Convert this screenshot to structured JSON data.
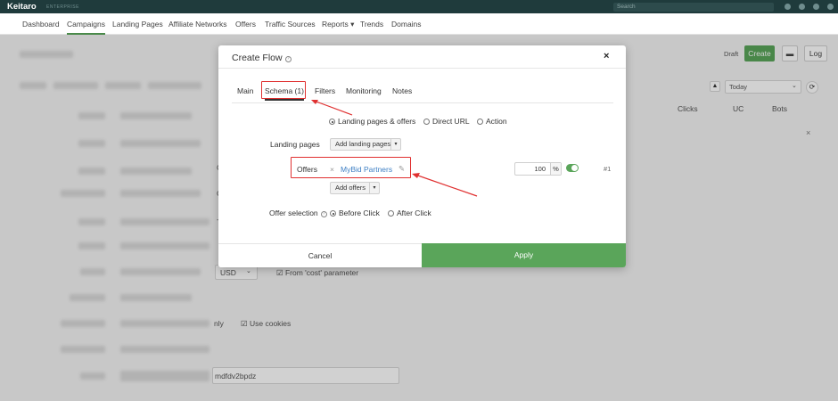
{
  "app": {
    "logo": "Keitaro",
    "logo_sub": "ENTERPRISE",
    "search_placeholder": "Search"
  },
  "nav": [
    "Dashboard",
    "Campaigns",
    "Landing Pages",
    "Affiliate Networks",
    "Offers",
    "Traffic Sources",
    "Reports ▾",
    "Trends",
    "Domains"
  ],
  "toolbar": {
    "draft": "Draft",
    "create": "Create",
    "log": "Log",
    "date_range": "Today"
  },
  "table_headers": {
    "clicks": "Clicks",
    "uc": "UC",
    "bots": "Bots"
  },
  "background": {
    "currency": "USD",
    "cost_param": "From 'cost' parameter",
    "only": "nly",
    "use_cookies": "Use cookies",
    "token": "mdfdv2bpdz"
  },
  "modal": {
    "title": "Create Flow",
    "tabs": [
      "Main",
      "Schema (1)",
      "Filters",
      "Monitoring",
      "Notes"
    ],
    "schema_options": [
      "Landing pages & offers",
      "Direct URL",
      "Action"
    ],
    "landing_pages_label": "Landing pages",
    "add_landing_pages": "Add landing pages",
    "offers_label": "Offers",
    "offer_name": "MyBid Partners",
    "offer_weight": "100",
    "weight_unit": "%",
    "offer_index": "#1",
    "add_offers": "Add offers",
    "offer_selection_label": "Offer selection",
    "offer_selection_options": [
      "Before Click",
      "After Click"
    ],
    "cancel": "Cancel",
    "apply": "Apply"
  },
  "colors": {
    "accent": "#5aa55a",
    "topbar": "#1f3b3c",
    "highlight": "#e03030",
    "link": "#3d7fc4"
  }
}
